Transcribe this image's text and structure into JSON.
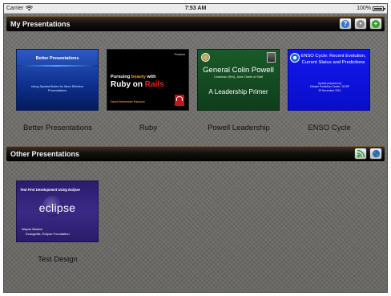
{
  "status_bar": {
    "carrier": "Carrier",
    "time": "7:53 AM",
    "battery": "100%",
    "battery_level": 1.0,
    "icons": [
      "wifi-icon",
      "battery-icon"
    ]
  },
  "sections": {
    "my": {
      "title": "My Presentations",
      "buttons": [
        "info-icon",
        "settings-icon",
        "add-icon"
      ]
    },
    "other": {
      "title": "Other Presentations",
      "buttons": [
        "wifi-share-icon",
        "globe-icon"
      ]
    }
  },
  "presentations": {
    "better": {
      "caption": "Better Presentations",
      "slide_title": "Better Presentations",
      "slide_subtitle": "Using SpeakerNotes for More Effective Presentations"
    },
    "ruby": {
      "caption": "Ruby",
      "brand": "Prowess",
      "line1_a": "Pursuing ",
      "line1_b": "beauty",
      "line1_c": " with",
      "line2_a": "Ruby on ",
      "line2_b": "Rails",
      "author": "David Heinemeier Hansson"
    },
    "powell": {
      "caption": "Powell Leadership",
      "name": "General Colin Powell",
      "sub1": "Chairman (Ret), Joint Chiefs of Staff",
      "primer": "A Leadership Primer"
    },
    "enso": {
      "caption": "ENSO Cycle",
      "title": "ENSO Cycle: Recent Evolution, Current Status and Predictions",
      "meta1": "Update prepared by",
      "meta2": "Climate Prediction Center / NCEP",
      "meta3": "29 November 2010"
    },
    "eclipse": {
      "caption": "Test Design",
      "head": "Test First Development Using Eclipse",
      "word": "eclipse",
      "person": "Wayne Beaton",
      "role": "Evangelist, Eclipse Foundation"
    }
  },
  "colors": {
    "background": "#6d6b68",
    "bar": "#15110d",
    "info_button": "#2f79d6",
    "settings_button": "#8a8a8a",
    "add_button": "#3aa02f"
  }
}
